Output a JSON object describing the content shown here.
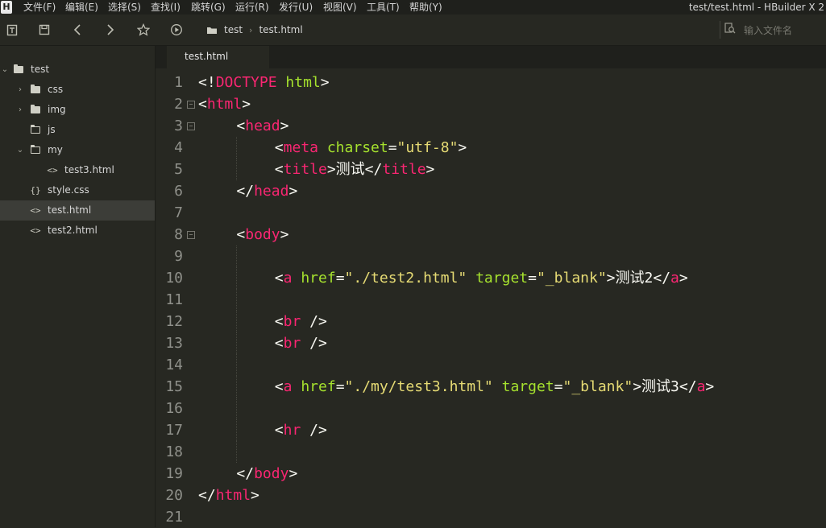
{
  "app": {
    "logo": "H",
    "window_title": "test/test.html - HBuilder X 2"
  },
  "menu": [
    {
      "label": "文件(F)"
    },
    {
      "label": "编辑(E)"
    },
    {
      "label": "选择(S)"
    },
    {
      "label": "查找(I)"
    },
    {
      "label": "跳转(G)"
    },
    {
      "label": "运行(R)"
    },
    {
      "label": "发行(U)"
    },
    {
      "label": "视图(V)"
    },
    {
      "label": "工具(T)"
    },
    {
      "label": "帮助(Y)"
    }
  ],
  "toolbar": {
    "icons": [
      "new-file-icon",
      "save-icon",
      "back-icon",
      "forward-icon",
      "star-icon",
      "run-icon"
    ],
    "breadcrumb": [
      "test",
      "test.html"
    ],
    "search_placeholder": "输入文件名"
  },
  "sidebar": {
    "items": [
      {
        "label": "test",
        "type": "project",
        "expanded": true,
        "depth": 0
      },
      {
        "label": "css",
        "type": "folder",
        "expanded": false,
        "depth": 1
      },
      {
        "label": "img",
        "type": "folder",
        "expanded": false,
        "depth": 1
      },
      {
        "label": "js",
        "type": "folder",
        "expanded": false,
        "depth": 1
      },
      {
        "label": "my",
        "type": "folder",
        "expanded": true,
        "depth": 1
      },
      {
        "label": "test3.html",
        "type": "html",
        "depth": 2
      },
      {
        "label": "style.css",
        "type": "css",
        "depth": 1
      },
      {
        "label": "test.html",
        "type": "html",
        "depth": 1,
        "selected": true
      },
      {
        "label": "test2.html",
        "type": "html",
        "depth": 1
      }
    ]
  },
  "tabs": [
    {
      "label": "test.html",
      "active": true
    }
  ],
  "editor": {
    "lines": [
      {
        "n": "1",
        "fold": false,
        "indent": 0,
        "tokens": [
          [
            "punct",
            "<!"
          ],
          [
            "tag",
            "DOCTYPE"
          ],
          [
            "punct",
            " "
          ],
          [
            "attr",
            "html"
          ],
          [
            "punct",
            ">"
          ]
        ]
      },
      {
        "n": "2",
        "fold": true,
        "indent": 0,
        "tokens": [
          [
            "punct",
            "<"
          ],
          [
            "tag",
            "html"
          ],
          [
            "punct",
            ">"
          ]
        ]
      },
      {
        "n": "3",
        "fold": true,
        "indent": 1,
        "tokens": [
          [
            "punct",
            "<"
          ],
          [
            "tag",
            "head"
          ],
          [
            "punct",
            ">"
          ]
        ]
      },
      {
        "n": "4",
        "fold": false,
        "indent": 2,
        "tokens": [
          [
            "punct",
            "<"
          ],
          [
            "tag",
            "meta"
          ],
          [
            "punct",
            " "
          ],
          [
            "attr",
            "charset"
          ],
          [
            "punct",
            "="
          ],
          [
            "str",
            "\"utf-8\""
          ],
          [
            "punct",
            ">"
          ]
        ]
      },
      {
        "n": "5",
        "fold": false,
        "indent": 2,
        "tokens": [
          [
            "punct",
            "<"
          ],
          [
            "tag",
            "title"
          ],
          [
            "punct",
            ">"
          ],
          [
            "text",
            "测试"
          ],
          [
            "punct",
            "</"
          ],
          [
            "tag",
            "title"
          ],
          [
            "punct",
            ">"
          ]
        ]
      },
      {
        "n": "6",
        "fold": false,
        "indent": 1,
        "tokens": [
          [
            "punct",
            "</"
          ],
          [
            "tag",
            "head"
          ],
          [
            "punct",
            ">"
          ]
        ]
      },
      {
        "n": "7",
        "fold": false,
        "indent": 0,
        "tokens": []
      },
      {
        "n": "8",
        "fold": true,
        "indent": 1,
        "tokens": [
          [
            "punct",
            "<"
          ],
          [
            "tag",
            "body"
          ],
          [
            "punct",
            ">"
          ]
        ]
      },
      {
        "n": "9",
        "fold": false,
        "indent": 0,
        "tokens": []
      },
      {
        "n": "10",
        "fold": false,
        "indent": 2,
        "tokens": [
          [
            "punct",
            "<"
          ],
          [
            "tag",
            "a"
          ],
          [
            "punct",
            " "
          ],
          [
            "attr",
            "href"
          ],
          [
            "punct",
            "="
          ],
          [
            "str",
            "\"./test2.html\""
          ],
          [
            "punct",
            " "
          ],
          [
            "attr",
            "target"
          ],
          [
            "punct",
            "="
          ],
          [
            "str",
            "\"_blank\""
          ],
          [
            "punct",
            ">"
          ],
          [
            "text",
            "测试2"
          ],
          [
            "punct",
            "</"
          ],
          [
            "tag",
            "a"
          ],
          [
            "punct",
            ">"
          ]
        ]
      },
      {
        "n": "11",
        "fold": false,
        "indent": 0,
        "tokens": []
      },
      {
        "n": "12",
        "fold": false,
        "indent": 2,
        "tokens": [
          [
            "punct",
            "<"
          ],
          [
            "tag",
            "br"
          ],
          [
            "punct",
            " />"
          ]
        ]
      },
      {
        "n": "13",
        "fold": false,
        "indent": 2,
        "tokens": [
          [
            "punct",
            "<"
          ],
          [
            "tag",
            "br"
          ],
          [
            "punct",
            " />"
          ]
        ]
      },
      {
        "n": "14",
        "fold": false,
        "indent": 0,
        "tokens": []
      },
      {
        "n": "15",
        "fold": false,
        "indent": 2,
        "tokens": [
          [
            "punct",
            "<"
          ],
          [
            "tag",
            "a"
          ],
          [
            "punct",
            " "
          ],
          [
            "attr",
            "href"
          ],
          [
            "punct",
            "="
          ],
          [
            "str",
            "\"./my/test3.html\""
          ],
          [
            "punct",
            " "
          ],
          [
            "attr",
            "target"
          ],
          [
            "punct",
            "="
          ],
          [
            "str",
            "\"_blank\""
          ],
          [
            "punct",
            ">"
          ],
          [
            "text",
            "测试3"
          ],
          [
            "punct",
            "</"
          ],
          [
            "tag",
            "a"
          ],
          [
            "punct",
            ">"
          ]
        ]
      },
      {
        "n": "16",
        "fold": false,
        "indent": 0,
        "tokens": []
      },
      {
        "n": "17",
        "fold": false,
        "indent": 2,
        "tokens": [
          [
            "punct",
            "<"
          ],
          [
            "tag",
            "hr"
          ],
          [
            "punct",
            " />"
          ]
        ]
      },
      {
        "n": "18",
        "fold": false,
        "indent": 0,
        "tokens": []
      },
      {
        "n": "19",
        "fold": false,
        "indent": 1,
        "tokens": [
          [
            "punct",
            "</"
          ],
          [
            "tag",
            "body"
          ],
          [
            "punct",
            ">"
          ]
        ]
      },
      {
        "n": "20",
        "fold": false,
        "indent": 0,
        "tokens": [
          [
            "punct",
            "</"
          ],
          [
            "tag",
            "html"
          ],
          [
            "punct",
            ">"
          ]
        ]
      },
      {
        "n": "21",
        "fold": false,
        "indent": 0,
        "tokens": []
      }
    ]
  },
  "colors": {
    "background": "#272822",
    "tag": "#f92672",
    "attribute": "#a6e22e",
    "string": "#e6db74",
    "punctuation": "#f8f8f2",
    "line_number": "#8f908a"
  }
}
